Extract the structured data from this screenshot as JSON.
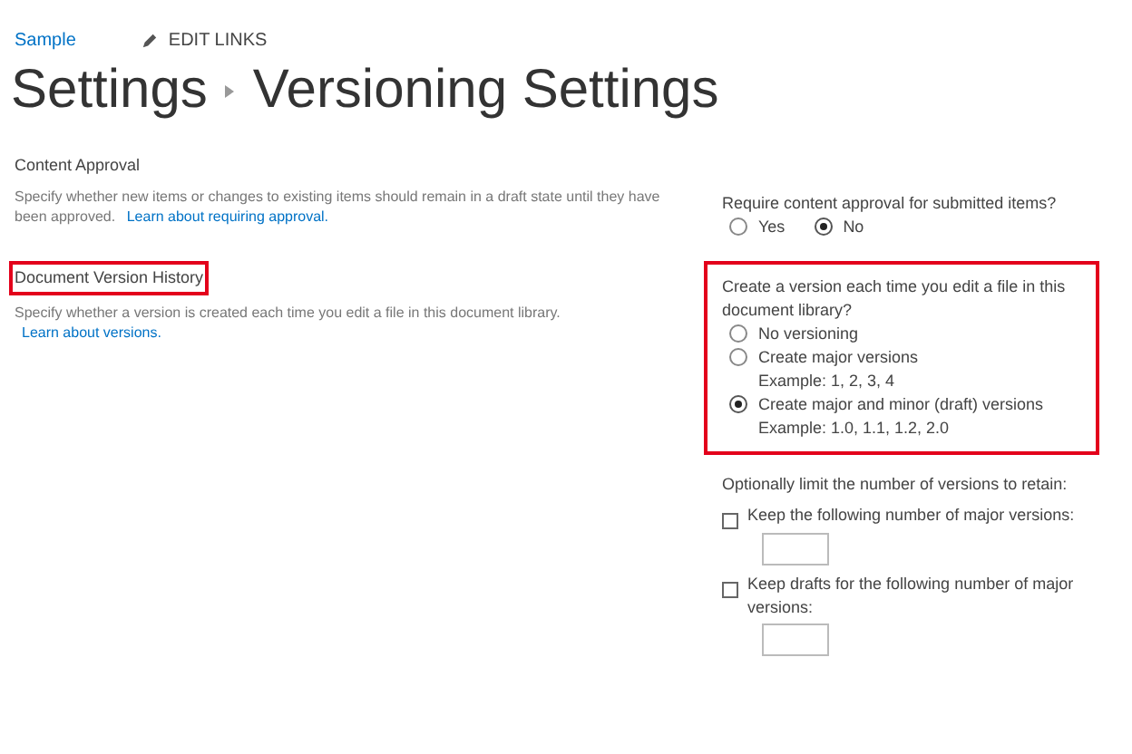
{
  "top_bar": {
    "site_link": "Sample",
    "edit_links": "EDIT LINKS"
  },
  "title": {
    "parent": "Settings",
    "current": "Versioning Settings"
  },
  "sections": [
    {
      "heading": "Content Approval",
      "highlighted": false,
      "description": "Specify whether new items or changes to existing items should remain in a draft state until they have been approved.",
      "link": "Learn about requiring approval.",
      "question": "Require content approval for submitted items?",
      "inline": true,
      "options": [
        {
          "label": "Yes",
          "selected": false
        },
        {
          "label": "No",
          "selected": true
        }
      ]
    },
    {
      "heading": "Document Version History",
      "highlighted": true,
      "description": "Specify whether a version is created each time you edit a file in this document library.",
      "link": "Learn about versions.",
      "question": "Create a version each time you edit a file in this document library?",
      "inline": false,
      "options": [
        {
          "label": "No versioning",
          "selected": false
        },
        {
          "label": "Create major versions",
          "example": "Example: 1, 2, 3, 4",
          "selected": false
        },
        {
          "label": "Create major and minor (draft) versions",
          "example": "Example: 1.0, 1.1, 1.2, 2.0",
          "selected": true
        }
      ]
    }
  ],
  "limits": {
    "question": "Optionally limit the number of versions to retain:",
    "items": [
      {
        "label": "Keep the following number of major versions:",
        "checked": false
      },
      {
        "label": "Keep drafts for the following number of major versions:",
        "checked": false
      }
    ]
  }
}
